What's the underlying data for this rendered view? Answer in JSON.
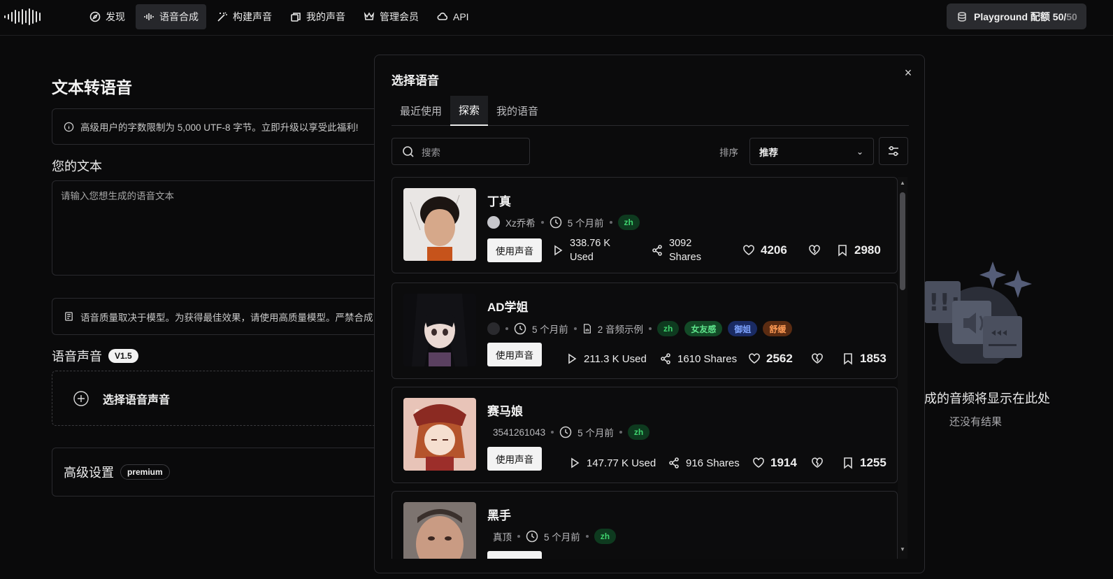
{
  "nav": {
    "items": [
      {
        "label": "发现",
        "icon": "compass-icon"
      },
      {
        "label": "语音合成",
        "icon": "waveform-icon",
        "active": true
      },
      {
        "label": "构建声音",
        "icon": "magic-wand-icon"
      },
      {
        "label": "我的声音",
        "icon": "copy-icon"
      },
      {
        "label": "管理会员",
        "icon": "crown-icon"
      },
      {
        "label": "API",
        "icon": "cloud-icon"
      }
    ],
    "quota_prefix": "Playground 配额 50/",
    "quota_total": "50"
  },
  "page": {
    "title": "文本转语音",
    "notice": "高级用户的字数限制为 5,000 UTF-8 字节。立即升级以享受此福利!",
    "your_text_label": "您的文本",
    "textarea_placeholder": "请输入您想生成的语音文本",
    "quality_notice": "语音质量取决于模型。为获得最佳效果，请使用高质量模型。严禁合成",
    "voice_label": "语音声音",
    "voice_version": "V1.5",
    "select_voice": "选择语音声音",
    "advanced_label": "高级设置",
    "advanced_badge": "premium",
    "result_text": "成的音频将显示在此处",
    "result_sub": "还没有结果"
  },
  "modal": {
    "title": "选择语音",
    "close": "×",
    "tabs": [
      "最近使用",
      "探索",
      "我的语音"
    ],
    "active_tab": 1,
    "search_placeholder": "搜索",
    "sort_label": "排序",
    "sort_value": "推荐",
    "use_button": "使用声音",
    "voices": [
      {
        "name": "丁真",
        "author": "Xz乔希",
        "time": "5 个月前",
        "tags": [
          "zh"
        ],
        "used_num": "338.76 K",
        "used_word": "Used",
        "shares_num": "3092",
        "shares_word": "Shares",
        "likes": "4206",
        "bookmarks": "2980"
      },
      {
        "name": "AD学姐",
        "author": "",
        "time": "5 个月前",
        "samples": "2 音频示例",
        "tags": [
          "zh",
          "女友感",
          "御姐",
          "舒缓"
        ],
        "used": "211.3 K Used",
        "shares": "1610 Shares",
        "likes": "2562",
        "bookmarks": "1853"
      },
      {
        "name": "赛马娘",
        "author": "3541261043",
        "time": "5 个月前",
        "tags": [
          "zh"
        ],
        "used": "147.77 K Used",
        "shares": "916 Shares",
        "likes": "1914",
        "bookmarks": "1255"
      },
      {
        "name": "黑手",
        "author": "真顶",
        "time": "5 个月前",
        "tags": [
          "zh"
        ]
      }
    ]
  },
  "colors": {
    "background": "#0a0a0b",
    "tag_green": "#3fd36e",
    "tag_blue": "#7ea4ff",
    "tag_orange": "#ff9b55"
  }
}
